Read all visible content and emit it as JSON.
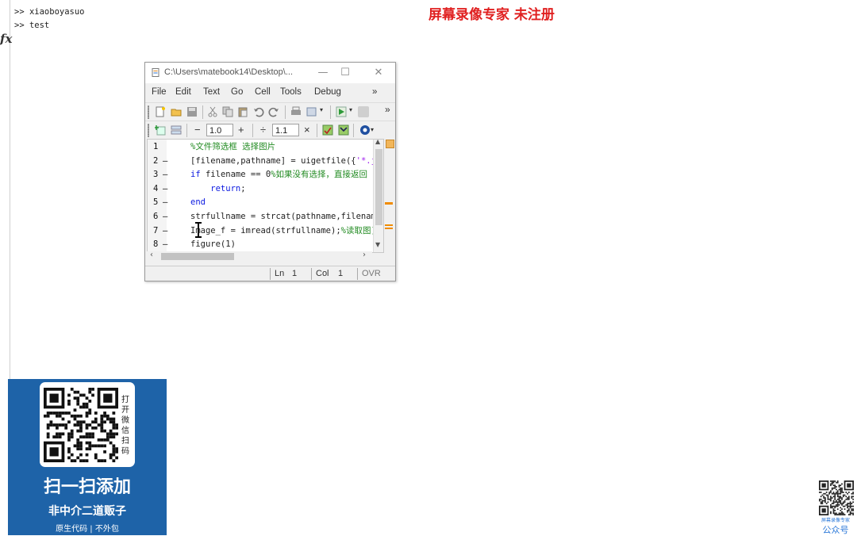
{
  "command_window": {
    "lines": [
      ">> xiaoboyasuo",
      ">> test"
    ],
    "fx_label": "fx"
  },
  "watermark": "屏幕录像专家  未注册",
  "editor": {
    "title": "C:\\Users\\matebook14\\Desktop\\...",
    "window_controls": {
      "minimize": "—",
      "maximize": "☐",
      "close": "✕"
    },
    "menu": [
      "File",
      "Edit",
      "Text",
      "Go",
      "Cell",
      "Tools",
      "Debug"
    ],
    "menu_overflow": "»",
    "toolbar_overflow": "»",
    "cell_toolbar": {
      "minus": "−",
      "value1": "1.0",
      "plus": "+",
      "divide": "÷",
      "value2": "1.1",
      "times": "×"
    },
    "code_lines": [
      {
        "num": "1",
        "dash": "",
        "segments": [
          {
            "t": "%文件筛选框 选择图片",
            "c": "cm"
          }
        ]
      },
      {
        "num": "2",
        "dash": "—",
        "segments": [
          {
            "t": "[filename,pathname] = uigetfile({",
            "c": ""
          },
          {
            "t": "'*.j",
            "c": "str"
          }
        ]
      },
      {
        "num": "3",
        "dash": "—",
        "segments": [
          {
            "t": "if",
            "c": "kw"
          },
          {
            "t": " filename == 0",
            "c": ""
          },
          {
            "t": "%如果没有选择，直接返回",
            "c": "cm"
          }
        ]
      },
      {
        "num": "4",
        "dash": "—",
        "segments": [
          {
            "t": "    return",
            "c": "kw"
          },
          {
            "t": ";",
            "c": ""
          }
        ]
      },
      {
        "num": "5",
        "dash": "—",
        "segments": [
          {
            "t": "end",
            "c": "kw"
          }
        ]
      },
      {
        "num": "6",
        "dash": "—",
        "segments": [
          {
            "t": "strfullname = strcat(pathname,filenam",
            "c": ""
          }
        ]
      },
      {
        "num": "7",
        "dash": "—",
        "segments": [
          {
            "t": "Image_f = imread(strfullname);",
            "c": ""
          },
          {
            "t": "%读取图)",
            "c": "cm"
          }
        ]
      },
      {
        "num": "8",
        "dash": "—",
        "segments": [
          {
            "t": "figure(1)",
            "c": ""
          }
        ]
      }
    ],
    "status": {
      "ln_label": "Ln",
      "ln_value": "1",
      "col_label": "Col",
      "col_value": "1",
      "mode": "OVR"
    },
    "colors": {
      "keyword": "#0a18e0",
      "comment": "#228b22",
      "string": "#a020f0"
    }
  },
  "promo": {
    "side_text": "打开微信扫码",
    "title": "扫一扫添加",
    "subtitle": "非中介二道贩子",
    "tagline": "原生代码 | 不外包",
    "bg_color": "#1e63a8"
  },
  "corner": {
    "label_small": "屏幕录像专家",
    "label": "公众号"
  }
}
